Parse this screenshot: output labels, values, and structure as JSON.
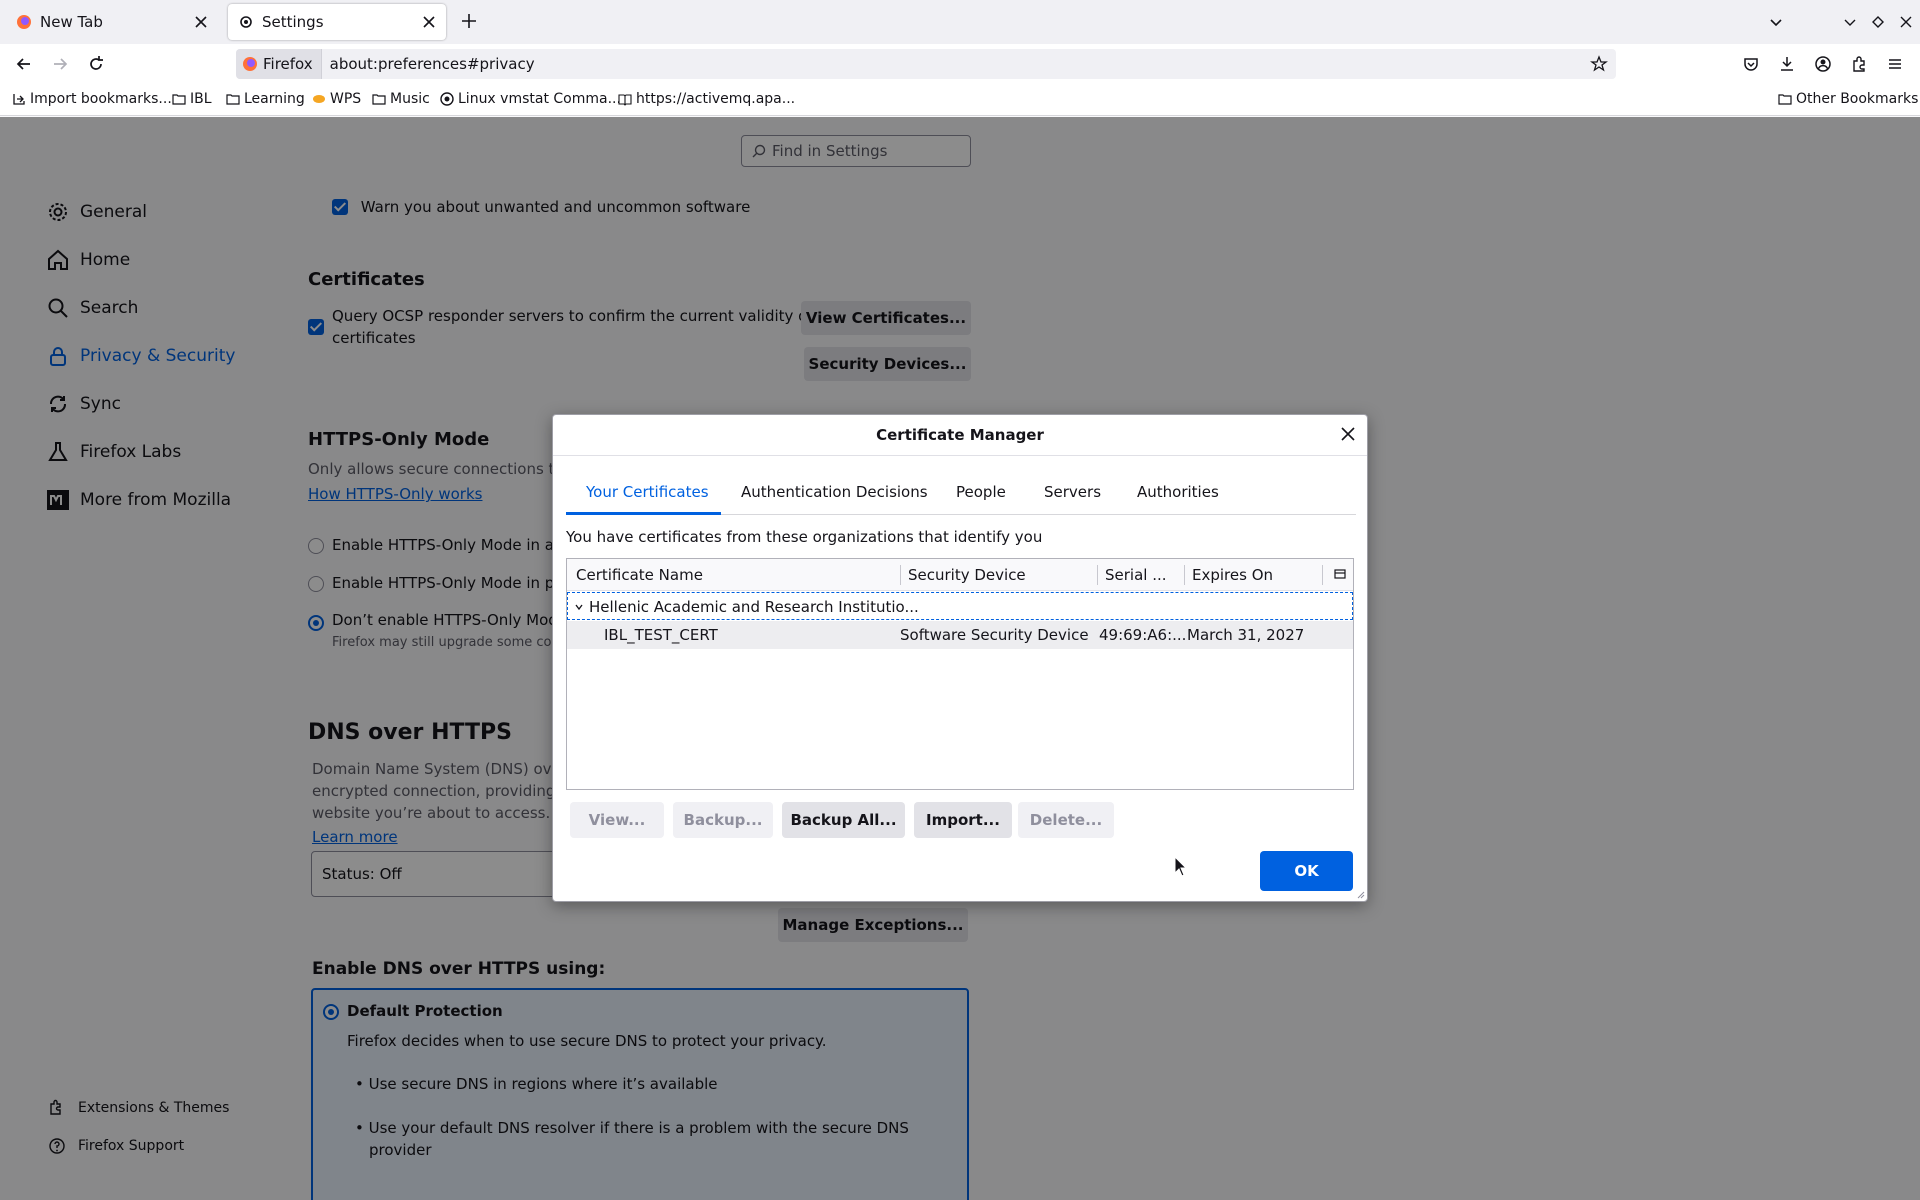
{
  "tabs": [
    {
      "label": "New Tab",
      "icon": "firefox-icon",
      "active": false
    },
    {
      "label": "Settings",
      "icon": "gear-icon",
      "active": true
    }
  ],
  "urlbar": {
    "identity_label": "Firefox",
    "url": "about:preferences#privacy"
  },
  "bookmarks": [
    {
      "label": "Import bookmarks...",
      "icon": "import-icon"
    },
    {
      "label": "IBL",
      "icon": "folder-icon"
    },
    {
      "label": "Learning",
      "icon": "folder-icon"
    },
    {
      "label": "WPS",
      "icon": "wps-icon"
    },
    {
      "label": "Music",
      "icon": "folder-icon"
    },
    {
      "label": "Linux vmstat Comma...",
      "icon": "site-icon"
    },
    {
      "label": "https://activemq.apa...",
      "icon": "book-icon"
    }
  ],
  "other_bookmarks": "Other Bookmarks",
  "settings": {
    "search_placeholder": "Find in Settings",
    "categories": [
      {
        "label": "General",
        "icon": "gear-icon"
      },
      {
        "label": "Home",
        "icon": "home-icon"
      },
      {
        "label": "Search",
        "icon": "search-icon"
      },
      {
        "label": "Privacy & Security",
        "icon": "lock-icon",
        "selected": true
      },
      {
        "label": "Sync",
        "icon": "sync-icon"
      },
      {
        "label": "Firefox Labs",
        "icon": "labs-icon"
      },
      {
        "label": "More from Mozilla",
        "icon": "mozilla-icon"
      }
    ],
    "footer_links": [
      {
        "label": "Extensions & Themes",
        "icon": "puzzle-icon"
      },
      {
        "label": "Firefox Support",
        "icon": "help-icon"
      }
    ],
    "warn_unwanted": "Warn you about unwanted and uncommon software",
    "certificates": {
      "heading": "Certificates",
      "ocsp_line1": "Query OCSP responder servers to confirm the current validity of",
      "ocsp_line2": "certificates",
      "view_button": "View Certificates...",
      "devices_button": "Security Devices..."
    },
    "https_only": {
      "heading": "HTTPS-Only Mode",
      "description": "Only allows secure connections to",
      "link": "How HTTPS-Only works",
      "options": [
        "Enable HTTPS-Only Mode in all",
        "Enable HTTPS-Only Mode in pri",
        "Don’t enable HTTPS-Only Mode"
      ],
      "note": "Firefox may still upgrade some conn"
    },
    "doh": {
      "heading": "DNS over HTTPS",
      "desc_line1": "Domain Name System (DNS) over",
      "desc_line2": "encrypted connection, providing a",
      "desc_line3": "website you’re about to access.",
      "learn_more": "Learn more",
      "status": "Status: Off",
      "manage_exceptions": "Manage Exceptions...",
      "enable_heading": "Enable DNS over HTTPS using:",
      "default_label": "Default Protection",
      "default_desc": "Firefox decides when to use secure DNS to protect your privacy.",
      "bullet1": "Use secure DNS in regions where it’s available",
      "bullet2_line1": "Use your default DNS resolver if there is a problem with the secure DNS",
      "bullet2_line2": "provider"
    }
  },
  "dialog": {
    "title": "Certificate Manager",
    "tabs": [
      "Your Certificates",
      "Authentication Decisions",
      "People",
      "Servers",
      "Authorities"
    ],
    "active_tab": "Your Certificates",
    "intro": "You have certificates from these organizations that identify you",
    "columns": [
      "Certificate Name",
      "Security Device",
      "Serial ...",
      "Expires On"
    ],
    "group": "Hellenic Academic and Research Institutio...",
    "rows": [
      {
        "name": "IBL_TEST_CERT",
        "device": "Software Security Device",
        "serial": "49:69:A6:...",
        "expires": "March 31, 2027"
      }
    ],
    "buttons": [
      {
        "label": "View...",
        "enabled": false
      },
      {
        "label": "Backup...",
        "enabled": false
      },
      {
        "label": "Backup All...",
        "enabled": true
      },
      {
        "label": "Import...",
        "enabled": true
      },
      {
        "label": "Delete...",
        "enabled": false
      }
    ],
    "ok_label": "OK"
  },
  "colors": {
    "accent": "#0061e0",
    "overlay": "rgba(0,0,0,0.45)"
  }
}
